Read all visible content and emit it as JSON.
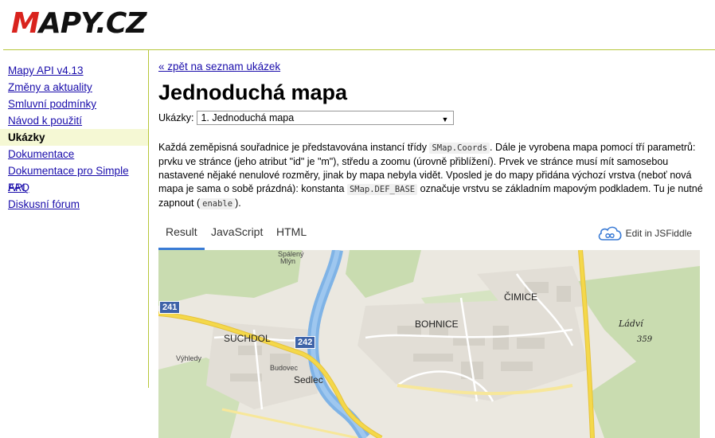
{
  "header": {
    "logo_prefix": "M",
    "logo_rest": "APY.CZ"
  },
  "sidebar": {
    "items": [
      {
        "label": "Mapy API v4.13",
        "active": false
      },
      {
        "label": "Změny a aktuality",
        "active": false
      },
      {
        "label": "Smluvní podmínky",
        "active": false
      },
      {
        "label": "Návod k použití",
        "active": false
      },
      {
        "label": "Ukázky",
        "active": true
      },
      {
        "label": "Dokumentace",
        "active": false
      },
      {
        "label": "Dokumentace pro Simple API",
        "active": false
      },
      {
        "label": "FAQ",
        "active": false
      },
      {
        "label": "Diskusní fórum",
        "active": false
      }
    ]
  },
  "main": {
    "back_link": "« zpět na seznam ukázek",
    "title": "Jednoduchá mapa",
    "select_label": "Ukázky:",
    "select_value": "1. Jednoduchá mapa",
    "desc": {
      "p1": "Každá zeměpisná souřadnice je představována instancí třídy ",
      "c1": "SMap.Coords",
      "p2": ". Dále je vyrobena mapa pomocí tří parametrů: prvku ve stránce (jeho atribut \"id\" je \"m\"), středu a zoomu (úrovně přiblížení). Prvek ve stránce musí mít samosebou nastavené nějaké nenulové rozměry, jinak by mapa nebyla vidět. Vposled je do mapy přidána výchozí vrstva (neboť nová mapa je sama o sobě prázdná): konstanta ",
      "c2": "SMap.DEF_BASE",
      "p3": " označuje vrstvu se základním mapovým podkladem. Tu je nutné zapnout (",
      "c3": "enable",
      "p4": ")."
    },
    "tabs": [
      "Result",
      "JavaScript",
      "HTML"
    ],
    "jsfiddle_label": "Edit in JSFiddle"
  },
  "map": {
    "labels": {
      "cimice": "ČIMICE",
      "bohnice": "BOHNICE",
      "suchdol": "SUCHDOL",
      "sedlec": "Sedlec",
      "budovec": "Budovec",
      "vyhledy": "Výhledy",
      "spaleny_mlyn_1": "Spálený",
      "spaleny_mlyn_2": "Mlýn",
      "ladvi": "Ládví",
      "elev": "359"
    },
    "shields": {
      "r241": "241",
      "r242": "242"
    },
    "colors": {
      "water": "#7fb3e6",
      "forest": "#c9dcb0",
      "road_main": "#f4d84a",
      "urban": "#e0ddd4"
    }
  }
}
